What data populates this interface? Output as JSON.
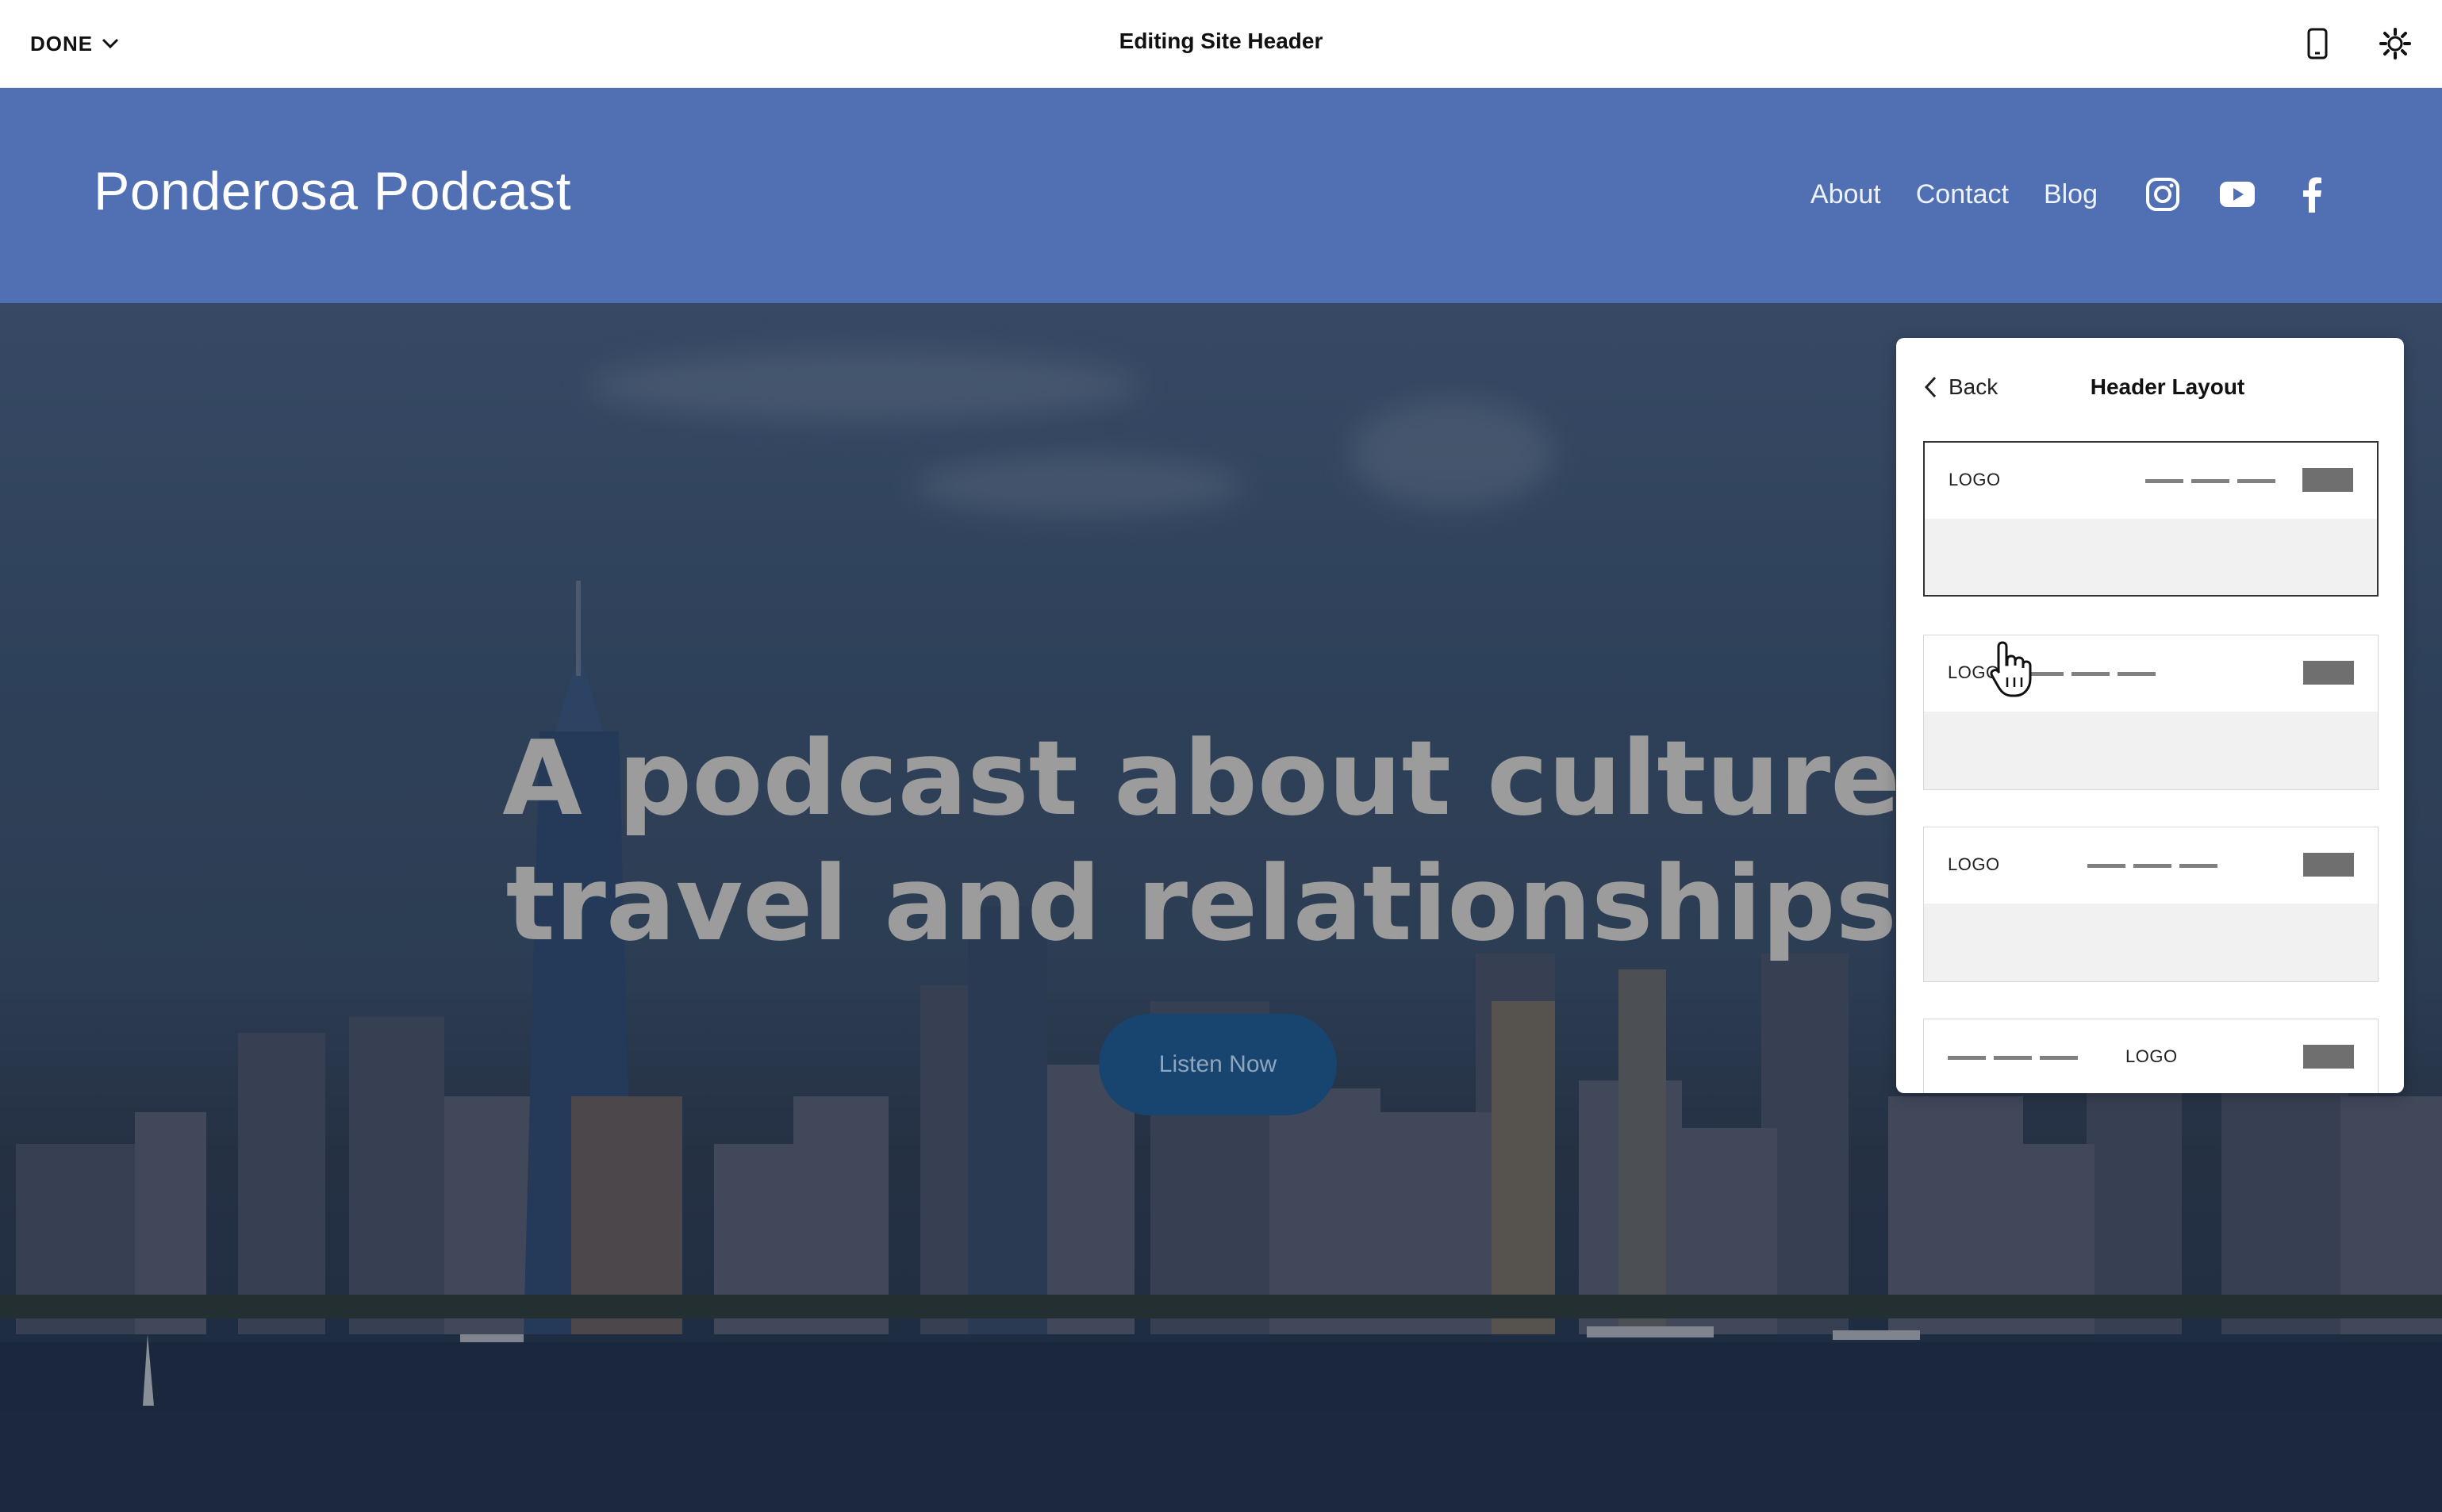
{
  "editor": {
    "done_label": "DONE",
    "title": "Editing Site Header"
  },
  "site": {
    "title": "Ponderosa Podcast",
    "nav": [
      "About",
      "Contact",
      "Blog"
    ],
    "social_icons": [
      "instagram-icon",
      "youtube-icon",
      "facebook-icon"
    ]
  },
  "hero": {
    "line1": "A podcast about culture,",
    "line2": "travel and relationships.",
    "button_label": "Listen Now"
  },
  "panel": {
    "back_label": "Back",
    "title": "Header Layout",
    "options": [
      {
        "logo_label": "LOGO",
        "selected": true
      },
      {
        "logo_label": "LOGO",
        "selected": false
      },
      {
        "logo_label": "LOGO",
        "selected": false
      },
      {
        "logo_label": "LOGO",
        "selected": false
      }
    ]
  },
  "colors": {
    "header_bg": "#5170b4",
    "button_bg": "#18456f",
    "panel_bg": "#ffffff"
  }
}
